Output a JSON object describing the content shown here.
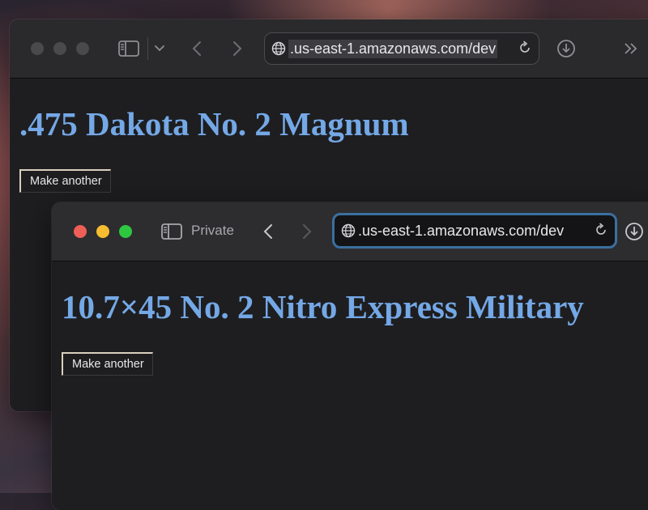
{
  "windows": [
    {
      "id": "back",
      "url": ".us-east-1.amazonaws.com/dev",
      "heading": ".475 Dakota No. 2 Magnum",
      "button_label": "Make another",
      "focused": false
    },
    {
      "id": "front",
      "private_label": "Private",
      "url": ".us-east-1.amazonaws.com/dev",
      "heading": "10.7×45 No. 2 Nitro Express Military",
      "button_label": "Make another",
      "focused": true
    }
  ],
  "colors": {
    "heading": "#74a8e6",
    "url_focus_ring": "#3b6fa0",
    "traffic_red": "#ee5f57",
    "traffic_yellow": "#f5bd2f",
    "traffic_green": "#2ec840"
  },
  "icons": [
    "globe-icon",
    "reload-icon",
    "sidebar-icon",
    "chevron-down-icon",
    "back-icon",
    "forward-icon",
    "download-icon",
    "overflow-icon"
  ]
}
